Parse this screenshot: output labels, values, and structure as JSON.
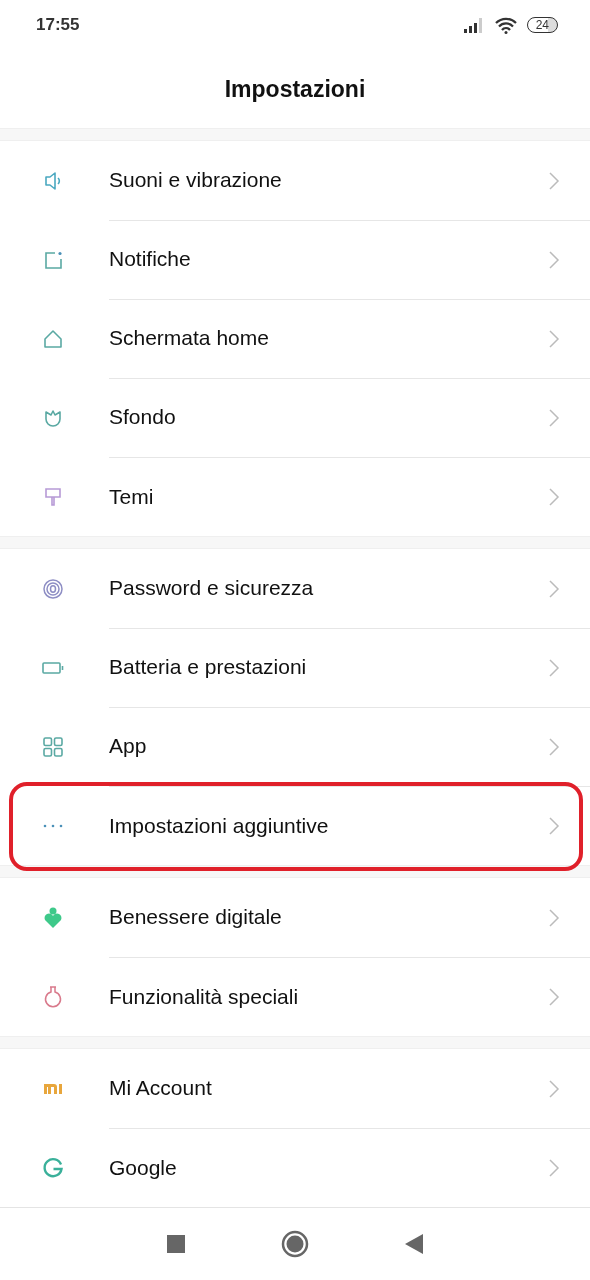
{
  "status_bar": {
    "time": "17:55",
    "battery": "24"
  },
  "title": "Impostazioni",
  "sections": [
    {
      "items": [
        {
          "label": "Suoni e vibrazione",
          "highlighted": false
        },
        {
          "label": "Notifiche",
          "highlighted": false
        },
        {
          "label": "Schermata home",
          "highlighted": false
        },
        {
          "label": "Sfondo",
          "highlighted": false
        },
        {
          "label": "Temi",
          "highlighted": false
        }
      ]
    },
    {
      "items": [
        {
          "label": "Password e sicurezza",
          "highlighted": false
        },
        {
          "label": "Batteria e prestazioni",
          "highlighted": false
        },
        {
          "label": "App",
          "highlighted": false
        },
        {
          "label": "Impostazioni aggiuntive",
          "highlighted": true
        }
      ]
    },
    {
      "items": [
        {
          "label": "Benessere digitale",
          "highlighted": false
        },
        {
          "label": "Funzionalità speciali",
          "highlighted": false
        }
      ]
    },
    {
      "items": [
        {
          "label": "Mi Account",
          "highlighted": false
        },
        {
          "label": "Google",
          "highlighted": false
        }
      ]
    }
  ]
}
